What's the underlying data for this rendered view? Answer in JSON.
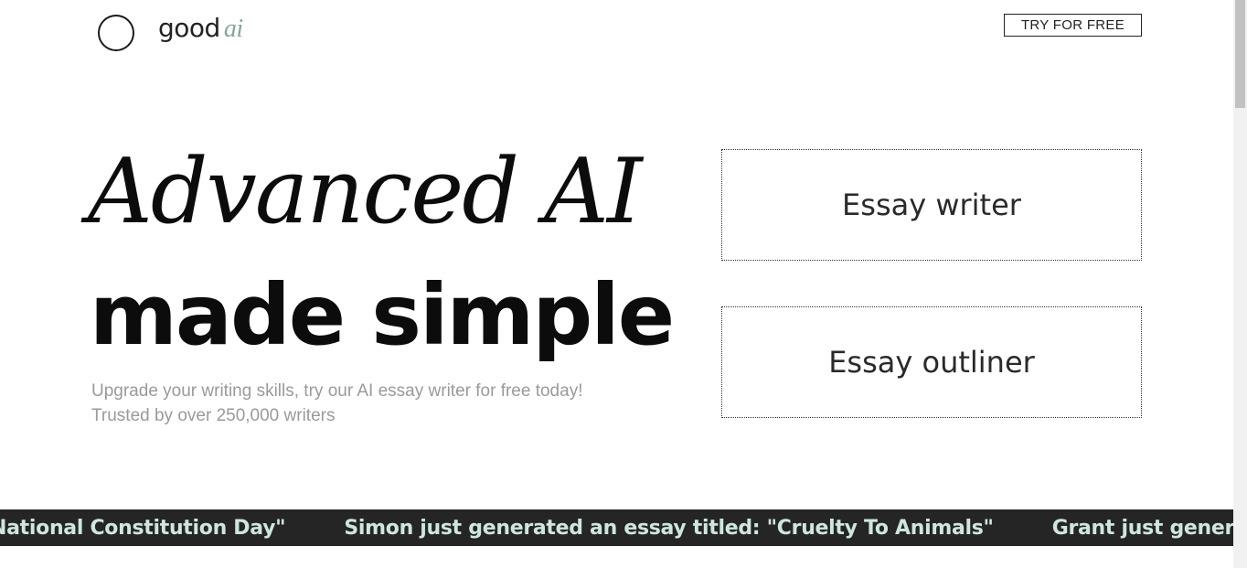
{
  "header": {
    "logo_word": "good",
    "logo_ai": "ai",
    "cta_label": "TRY FOR FREE"
  },
  "hero": {
    "line1": "Advanced AI",
    "line2": "made simple",
    "subtitle_line1": "Upgrade your writing skills, try our AI essay writer for free today!",
    "subtitle_line2": "Trusted by over 250,000 writers"
  },
  "features": {
    "essay_writer": "Essay writer",
    "essay_outliner": "Essay outliner"
  },
  "ticker": {
    "items": [
      ": \"National Constitution Day\"",
      "Simon just generated an essay titled: \"Cruelty To Animals\"",
      "Grant just generated an essay titled:"
    ]
  },
  "colors": {
    "ticker_bg": "#252525",
    "ticker_text": "#cfe6dd",
    "logo_ai_accent": "#8aa39a",
    "subtitle_text": "#9a9a9a"
  }
}
